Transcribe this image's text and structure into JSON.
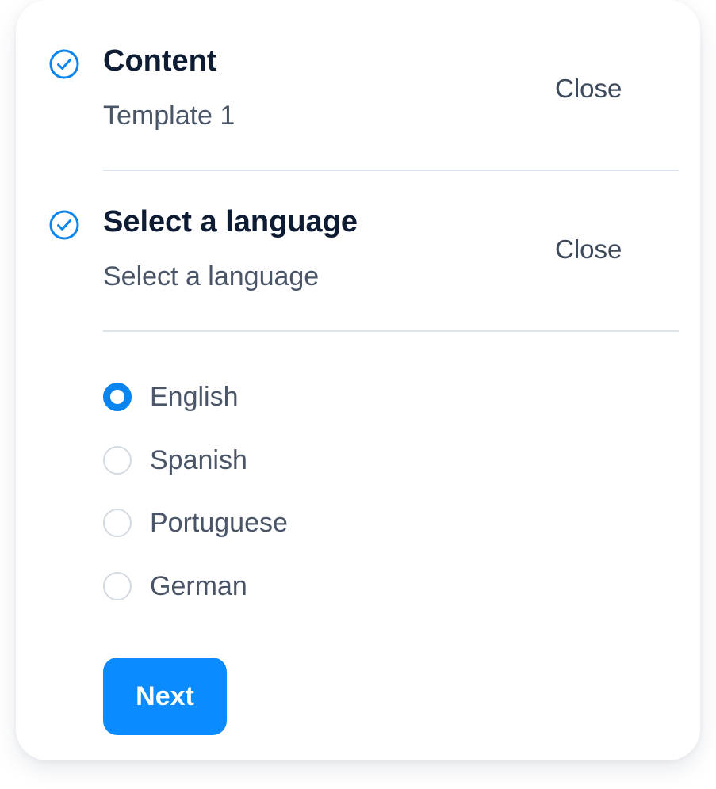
{
  "steps": [
    {
      "title": "Content",
      "subtitle": "Template 1",
      "close_label": "Close",
      "icon": "check-circle-icon"
    },
    {
      "title": "Select a language",
      "subtitle": "Select a language",
      "close_label": "Close",
      "icon": "check-circle-icon"
    }
  ],
  "languages": {
    "options": [
      {
        "label": "English",
        "selected": true
      },
      {
        "label": "Spanish",
        "selected": false
      },
      {
        "label": "Portuguese",
        "selected": false
      },
      {
        "label": "German",
        "selected": false
      }
    ]
  },
  "next_label": "Next",
  "colors": {
    "accent": "#0a8bff",
    "title": "#0d1b33",
    "text": "#4a5568",
    "divider": "#dde3ea"
  }
}
